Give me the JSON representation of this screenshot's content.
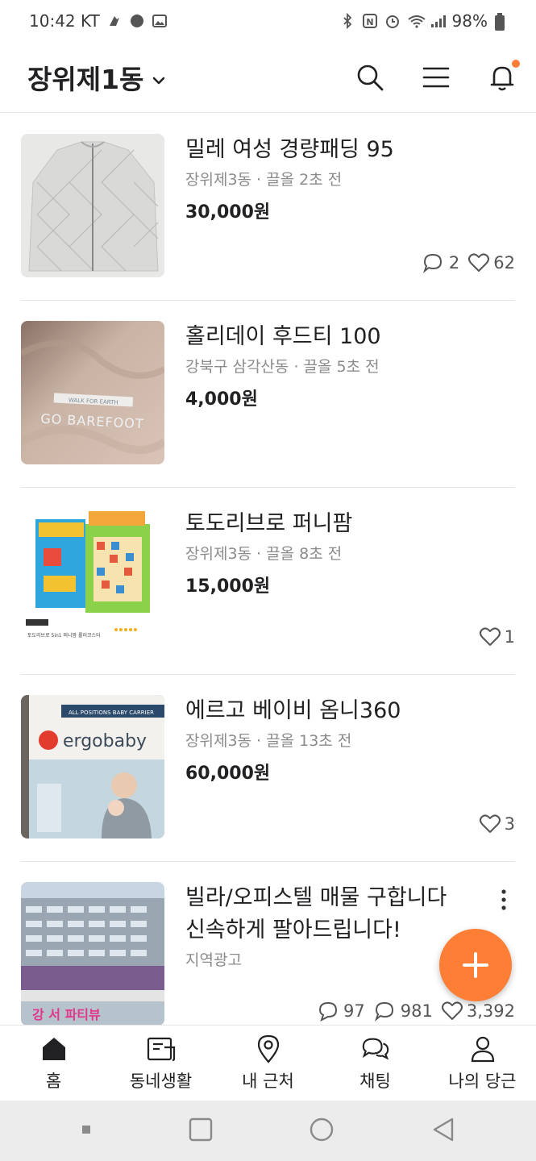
{
  "status_bar": {
    "time": "10:42 KT",
    "battery": "98%"
  },
  "header": {
    "location": "장위제1동"
  },
  "items": [
    {
      "title": "밀레 여성 경량패딩 95",
      "meta": "장위제3동 · 끌올 2초 전",
      "price": "30,000원",
      "comments": "2",
      "likes": "62"
    },
    {
      "title": "홀리데이 후드티 100",
      "meta": "강북구 삼각산동 · 끌올 5초 전",
      "price": "4,000원",
      "thumb_text_top": "WALK FOR EARTH",
      "thumb_text": "GO BAREFOOT"
    },
    {
      "title": "토도리브로 퍼니팜",
      "meta": "장위제3동 · 끌올 8초 전",
      "price": "15,000원",
      "likes": "1",
      "thumb_caption": "토도리브로 5in1 퍼니팜 롤러코스터"
    },
    {
      "title": "에르고 베이비 옴니360",
      "meta": "장위제3동 · 끌올 13초 전",
      "price": "60,000원",
      "likes": "3",
      "thumb_brand": "ergobaby",
      "thumb_banner": "ALL POSITIONS BABY CARRIER"
    },
    {
      "title_line1": "빌라/오피스텔 매물 구합니다",
      "title_line2": "신속하게 팔아드립니다!",
      "meta": "지역광고",
      "views": "97",
      "comments": "981",
      "likes": "3,392",
      "thumb_text": "강 서 파티뷰"
    }
  ],
  "bottom_nav": [
    {
      "label": "홈"
    },
    {
      "label": "동네생활"
    },
    {
      "label": "내 근처"
    },
    {
      "label": "채팅"
    },
    {
      "label": "나의 당근"
    }
  ],
  "colors": {
    "accent": "#ff7e36",
    "text": "#212124",
    "muted": "#8b8b8b"
  }
}
